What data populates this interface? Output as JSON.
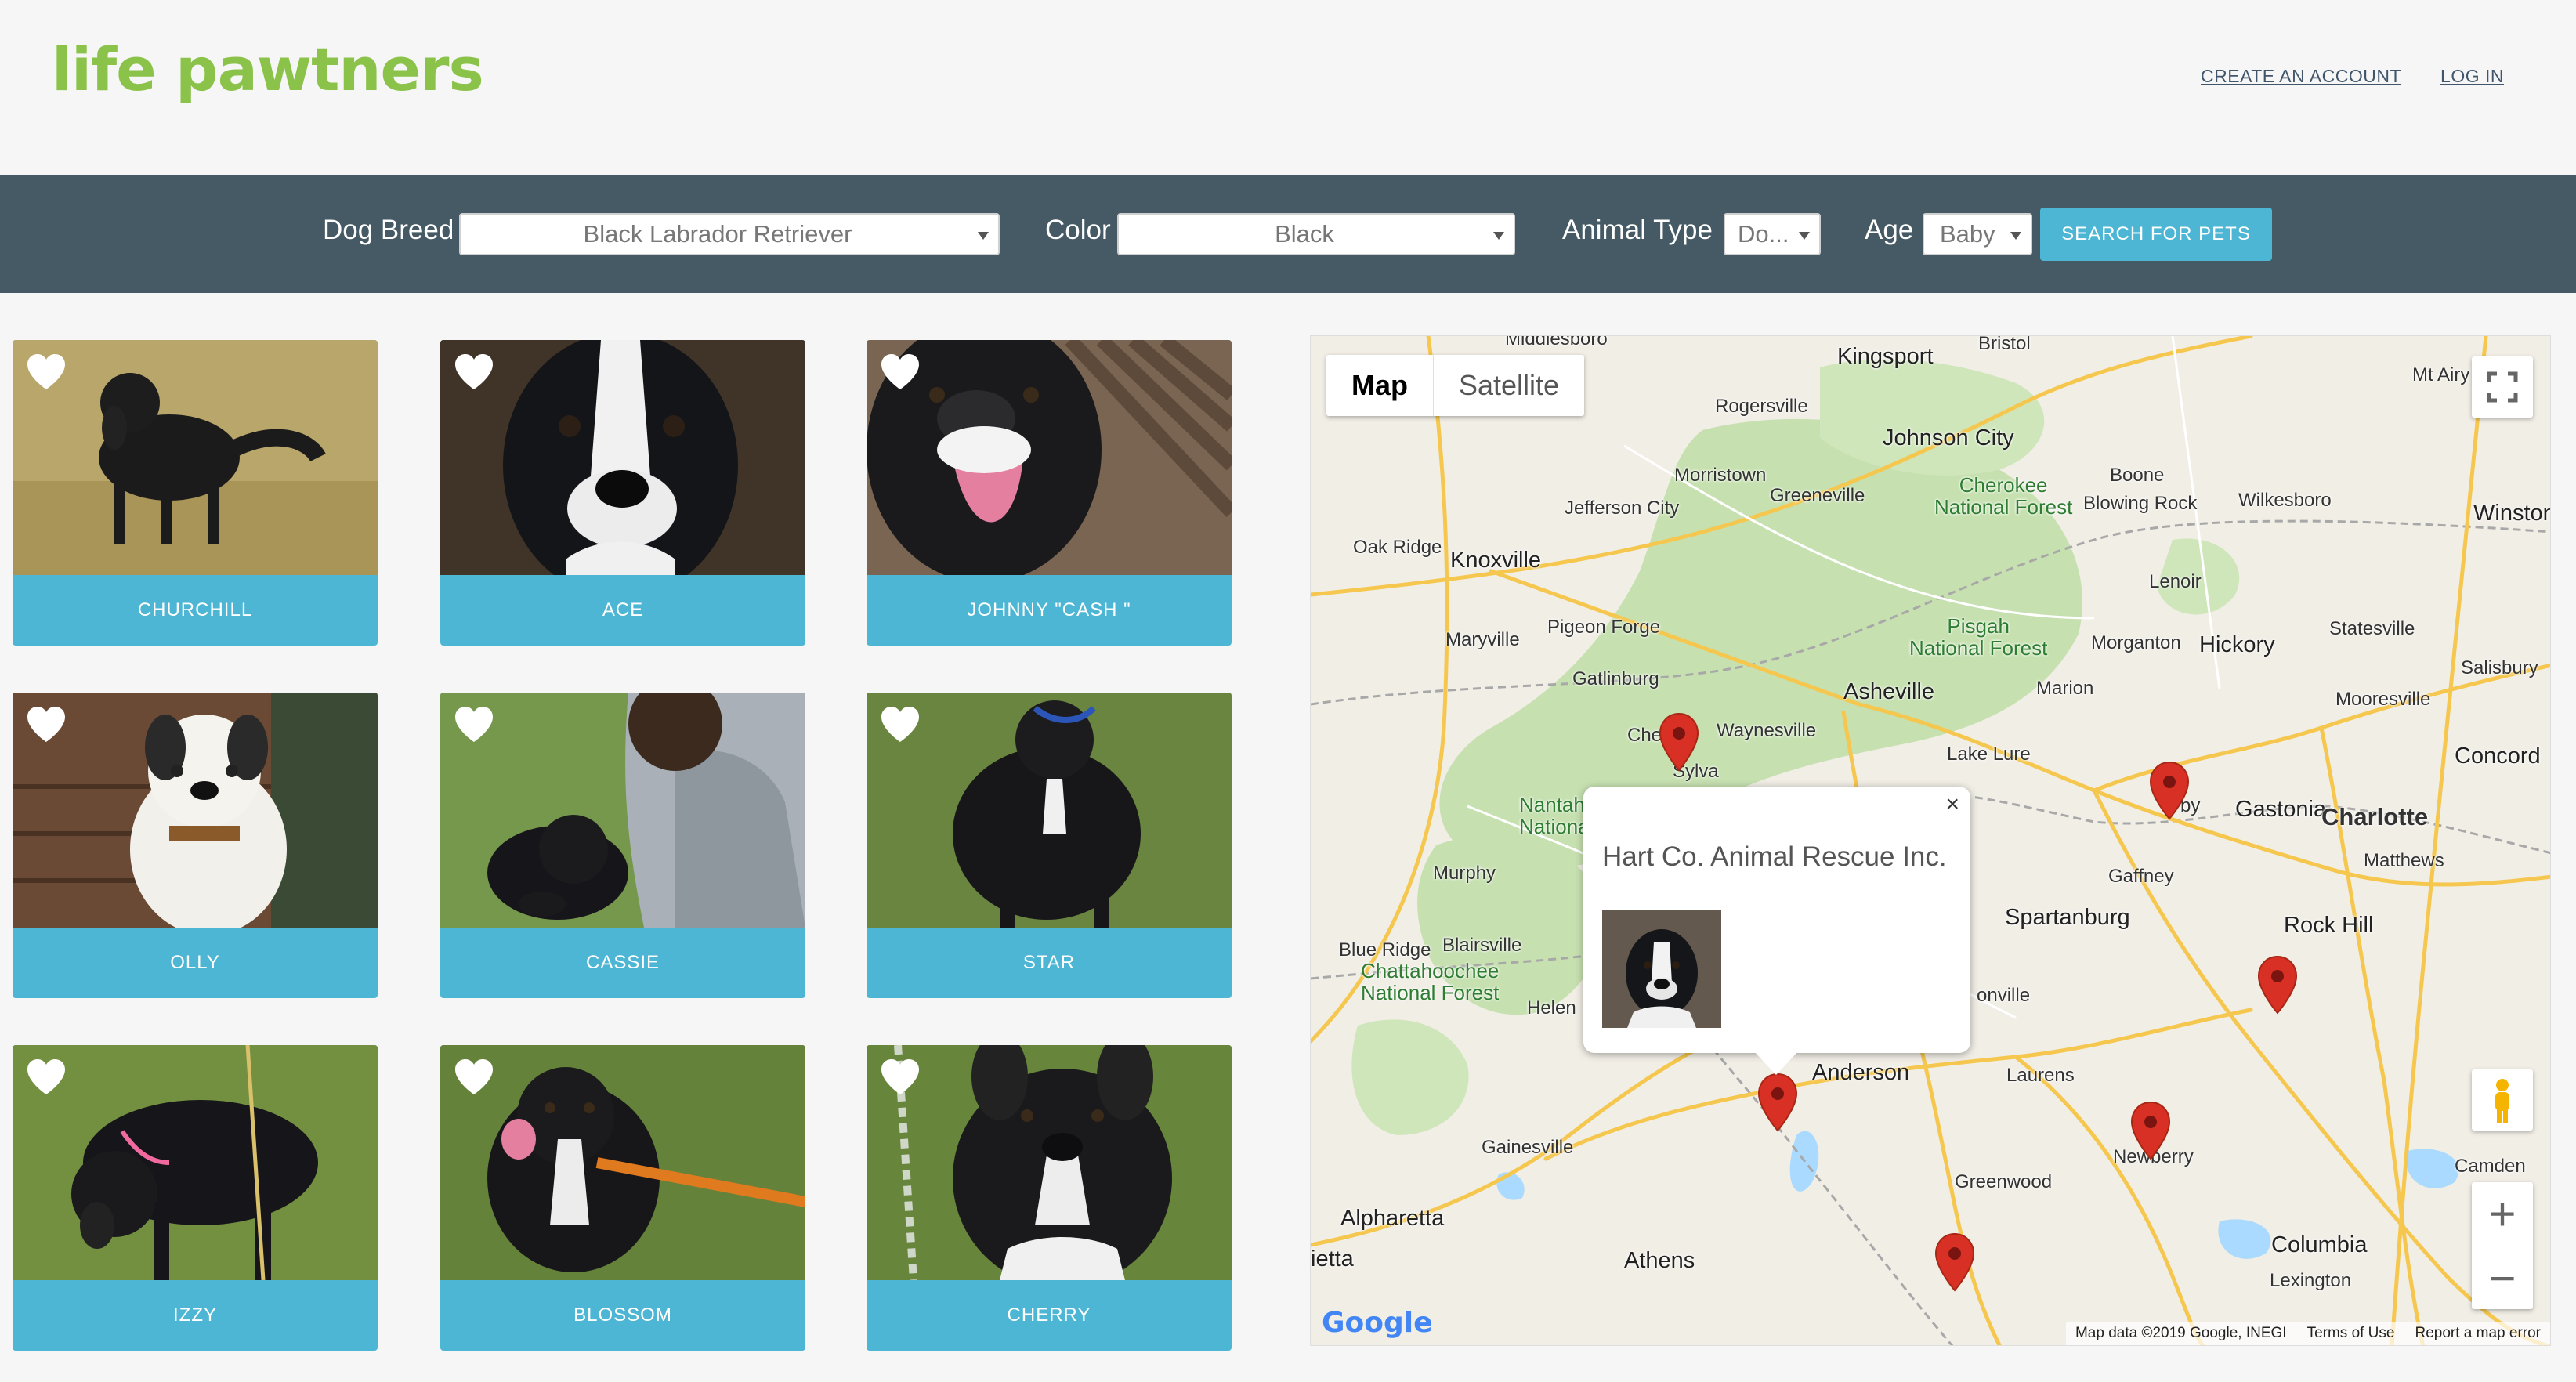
{
  "header": {
    "logo": "life pawtners",
    "create_account": "CREATE AN ACCOUNT",
    "log_in": "LOG IN"
  },
  "filters": {
    "breed": {
      "label": "Dog Breed",
      "value": "Black Labrador Retriever"
    },
    "color": {
      "label": "Color",
      "value": "Black"
    },
    "animal_type": {
      "label": "Animal Type",
      "value": "Do..."
    },
    "age": {
      "label": "Age",
      "value": "Baby"
    },
    "search_button": "SEARCH FOR PETS"
  },
  "pets": [
    {
      "name": "CHURCHILL"
    },
    {
      "name": "ACE"
    },
    {
      "name": "JOHNNY \"CASH \""
    },
    {
      "name": "OLLY"
    },
    {
      "name": "CASSIE"
    },
    {
      "name": "STAR"
    },
    {
      "name": "IZZY"
    },
    {
      "name": "BLOSSOM"
    },
    {
      "name": "CHERRY"
    }
  ],
  "map": {
    "map_tab": "Map",
    "satellite_tab": "Satellite",
    "info_title": "Hart Co. Animal Rescue Inc.",
    "close": "×",
    "zoom_in": "+",
    "zoom_out": "−",
    "google": "Google",
    "attribution": [
      "Map data ©2019 Google, INEGI",
      "Terms of Use",
      "Report a map error"
    ],
    "places": {
      "middlesboro": "Middlesboro",
      "bristol": "Bristol",
      "kingsport": "Kingsport",
      "rogersville": "Rogersville",
      "johnson_city": "Johnson City",
      "mt_airy": "Mt Airy",
      "morristown": "Morristown",
      "greeneville": "Greeneville",
      "cherokee_nf": "Cherokee\nNational Forest",
      "boone": "Boone",
      "blowing_rock": "Blowing Rock",
      "wilkesboro": "Wilkesboro",
      "winston": "Winston",
      "jefferson_city": "Jefferson City",
      "oak_ridge": "Oak Ridge",
      "knoxville": "Knoxville",
      "lenoir": "Lenoir",
      "maryville": "Maryville",
      "pigeon_forge": "Pigeon Forge",
      "pisgah_nf": "Pisgah\nNational Forest",
      "morganton": "Morganton",
      "hickory": "Hickory",
      "statesville": "Statesville",
      "salisbury": "Salisbury",
      "gatlinburg": "Gatlinburg",
      "asheville": "Asheville",
      "marion": "Marion",
      "mooresville": "Mooresville",
      "cherokee": "Cherc",
      "waynesville": "Waynesville",
      "sylva": "Sylva",
      "lake_lure": "Lake Lure",
      "concord": "Concord",
      "gastonia": "Gastonia",
      "charlotte": "Charlotte",
      "nantahala_nf": "Nantah\nNational F",
      "gaffney": "Gaffney",
      "matthews": "Matthews",
      "murphy": "Murphy",
      "spartanburg": "Spartanburg",
      "rock_hill": "Rock Hill",
      "blue_ridge": "Blue Ridge",
      "blairsville": "Blairsville",
      "chattahoochee_nf": "Chattahoochee\nNational Forest",
      "helen": "Helen",
      "anderson": "Anderson",
      "laurens": "Laurens",
      "gainesville": "Gainesville",
      "newberry": "Newberry",
      "camden": "Camden",
      "greenwood": "Greenwood",
      "alpharetta": "Alpharetta",
      "columbia": "Columbia",
      "marietta": "ietta",
      "athens": "Athens",
      "lexington": "Lexington",
      "kby": "by",
      "onville": "onville"
    }
  },
  "colors": {
    "logo": "#8bc34a",
    "filter_bar": "#455a64",
    "accent": "#4db6d4",
    "marker": "#d93025"
  }
}
